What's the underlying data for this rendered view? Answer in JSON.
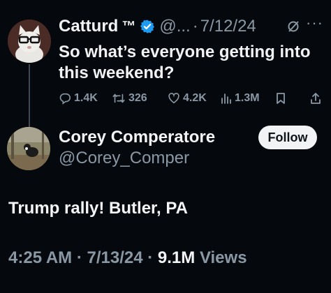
{
  "parent_tweet": {
    "author_name": "Catturd",
    "tm": "™",
    "handle": "@...",
    "separator": "·",
    "date": "7/12/24",
    "text": "So what’s everyone getting into this weekend?",
    "replies": "1.4K",
    "reposts": "326",
    "likes": "4.2K",
    "views": "1.3M"
  },
  "reply_tweet": {
    "author_name": "Corey Comperatore",
    "handle": "@Corey_Comper",
    "follow_label": "Follow",
    "text": "Trump rally! Butler, PA",
    "time": "4:25 AM",
    "separator": "·",
    "date": "7/13/24",
    "views_count": "9.1M",
    "views_label": "Views"
  },
  "icons": {
    "verified": "verified-badge-icon",
    "grok": "grok-icon",
    "more": "more-icon",
    "reply": "reply-icon",
    "repost": "repost-icon",
    "like": "like-icon",
    "views": "views-icon",
    "bookmark": "bookmark-icon",
    "share": "share-icon"
  },
  "colors": {
    "background": "#05080c",
    "text": "#f4f5f6",
    "muted": "#8a98a5",
    "verified": "#1d9bf0",
    "follow_bg": "#f2f3f4"
  }
}
